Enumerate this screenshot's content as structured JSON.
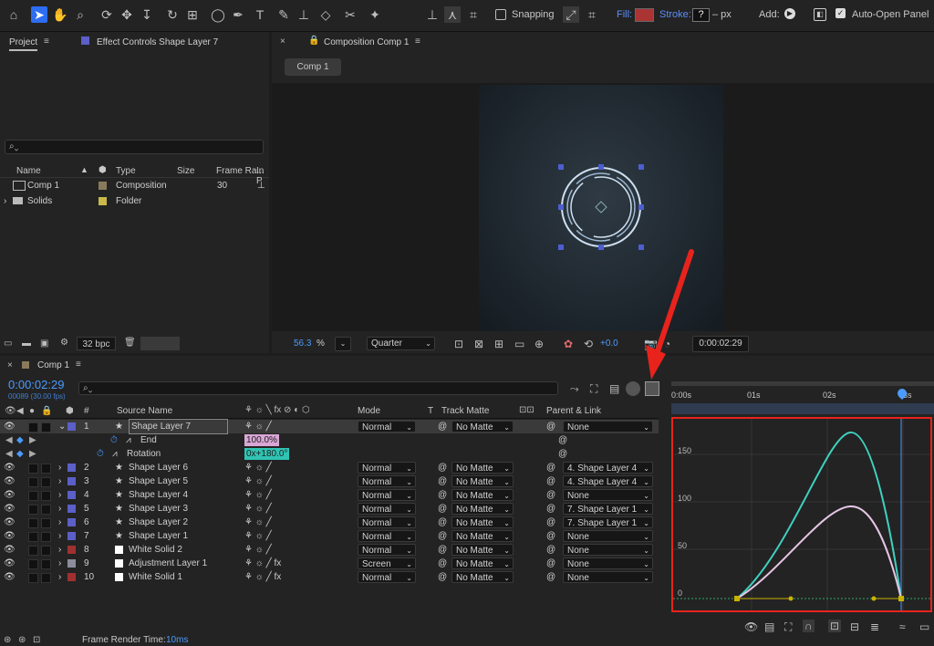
{
  "toolbar": {
    "snapping_label": "Snapping",
    "fill_label": "Fill:",
    "stroke_label": "Stroke:",
    "stroke_value": "?",
    "stroke_unit": "– px",
    "add_label": "Add:",
    "auto_open_label": "Auto-Open Panel"
  },
  "project_panel": {
    "tab_project": "Project",
    "tab_effect_controls": "Effect Controls Shape Layer 7",
    "columns": {
      "name": "Name",
      "type": "Type",
      "size": "Size",
      "frame_rate": "Frame Ra...",
      "in": "In P"
    },
    "items": [
      {
        "name": "Comp 1",
        "type": "Composition",
        "frame_rate": "30",
        "label_color": "#8a7a5c"
      },
      {
        "name": "Solids",
        "type": "Folder",
        "frame_rate": "",
        "label_color": "#c9b94a"
      }
    ],
    "bpc": "32 bpc"
  },
  "comp_viewer": {
    "tab_title": "Composition Comp 1",
    "comp_tab": "Comp 1",
    "zoom": "56.3",
    "zoom_unit": "%",
    "resolution": "Quarter",
    "exposure": "+0.0",
    "timecode": "0:00:02:29"
  },
  "timeline": {
    "tab": "Comp 1",
    "current_time": "0:00:02:29",
    "frame_info": "00089 (30.00 fps)",
    "col_number": "#",
    "col_source": "Source Name",
    "col_mode": "Mode",
    "col_t": "T",
    "col_track_matte": "Track Matte",
    "col_parent": "Parent & Link",
    "ruler": [
      "0:00s",
      "01s",
      "02s",
      "03s"
    ],
    "layers": [
      {
        "num": "1",
        "name": "Shape Layer 7",
        "color": "#5b5fc7",
        "mode": "Normal",
        "matte": "No Matte",
        "parent": "None",
        "type": "shape",
        "selected": true
      },
      {
        "num": "2",
        "name": "Shape Layer 6",
        "color": "#5b5fc7",
        "mode": "Normal",
        "matte": "No Matte",
        "parent": "4. Shape Layer 4",
        "type": "shape"
      },
      {
        "num": "3",
        "name": "Shape Layer 5",
        "color": "#5b5fc7",
        "mode": "Normal",
        "matte": "No Matte",
        "parent": "4. Shape Layer 4",
        "type": "shape"
      },
      {
        "num": "4",
        "name": "Shape Layer 4",
        "color": "#5b5fc7",
        "mode": "Normal",
        "matte": "No Matte",
        "parent": "None",
        "type": "shape"
      },
      {
        "num": "5",
        "name": "Shape Layer 3",
        "color": "#5b5fc7",
        "mode": "Normal",
        "matte": "No Matte",
        "parent": "7. Shape Layer 1",
        "type": "shape"
      },
      {
        "num": "6",
        "name": "Shape Layer 2",
        "color": "#5b5fc7",
        "mode": "Normal",
        "matte": "No Matte",
        "parent": "7. Shape Layer 1",
        "type": "shape"
      },
      {
        "num": "7",
        "name": "Shape Layer 1",
        "color": "#5b5fc7",
        "mode": "Normal",
        "matte": "No Matte",
        "parent": "None",
        "type": "shape"
      },
      {
        "num": "8",
        "name": "White Solid 2",
        "color": "#a03030",
        "mode": "Normal",
        "matte": "No Matte",
        "parent": "None",
        "type": "solid"
      },
      {
        "num": "9",
        "name": "Adjustment Layer 1",
        "color": "#8c8c9c",
        "mode": "Screen",
        "matte": "No Matte",
        "parent": "None",
        "type": "solid"
      },
      {
        "num": "10",
        "name": "White Solid 1",
        "color": "#a03030",
        "mode": "Normal",
        "matte": "No Matte",
        "parent": "None",
        "type": "solid"
      }
    ],
    "properties": [
      {
        "name": "End",
        "value": "100.0%",
        "value_color": "#d9a6d6"
      },
      {
        "name": "Rotation",
        "value": "0x+180.0°",
        "value_color": "#2fc4b3"
      }
    ],
    "frame_render_label": "Frame Render Time:",
    "frame_render_value": "10ms"
  },
  "graph_editor": {
    "y_ticks": [
      "150",
      "100",
      "50",
      "0"
    ],
    "curve_colors": {
      "rotation": "#3fd1c0",
      "end": "#e6c6e6"
    }
  },
  "colors": {
    "accent": "#2c6df2",
    "time_blue": "#4a9bff",
    "annotation_red": "#e8231c"
  }
}
